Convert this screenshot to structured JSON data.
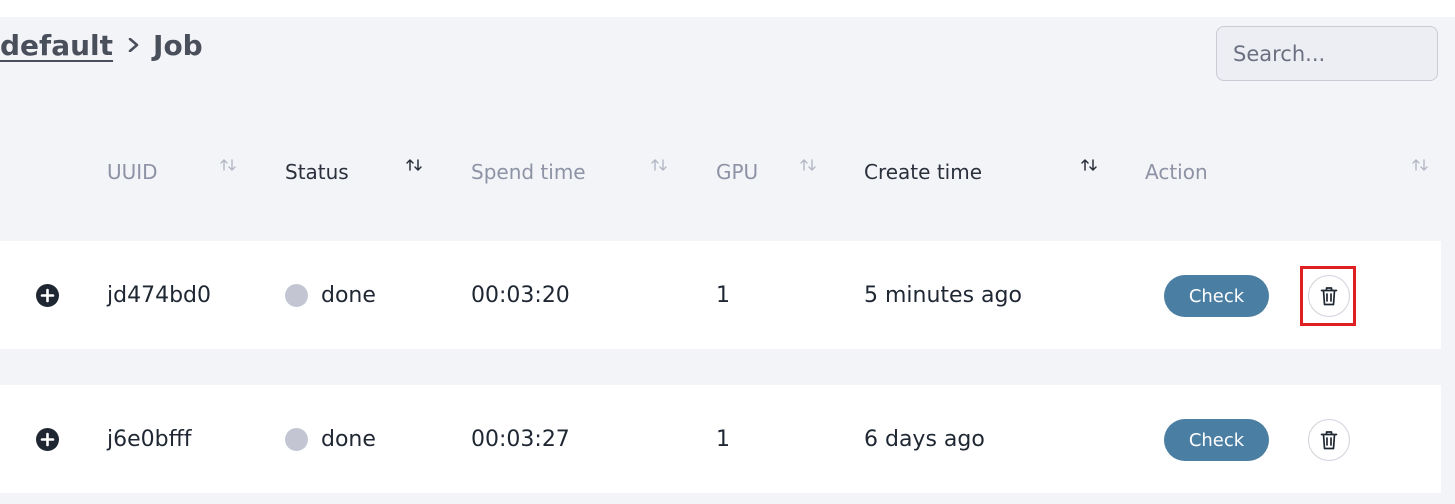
{
  "breadcrumb": {
    "parent": "default",
    "current": "Job"
  },
  "search": {
    "placeholder": "Search..."
  },
  "table": {
    "columns": [
      {
        "key": "uuid",
        "label": "UUID",
        "sort": "none"
      },
      {
        "key": "status",
        "label": "Status",
        "sort": "active"
      },
      {
        "key": "spend_time",
        "label": "Spend time",
        "sort": "none"
      },
      {
        "key": "gpu",
        "label": "GPU",
        "sort": "none"
      },
      {
        "key": "create_time",
        "label": "Create time",
        "sort": "active"
      },
      {
        "key": "action",
        "label": "Action",
        "sort": "none"
      }
    ],
    "rows": [
      {
        "uuid": "jd474bd0",
        "status": "done",
        "spend_time": "00:03:20",
        "gpu": "1",
        "create_time": "5 minutes ago",
        "action_label": "Check",
        "highlighted": true
      },
      {
        "uuid": "j6e0bfff",
        "status": "done",
        "spend_time": "00:03:27",
        "gpu": "1",
        "create_time": "6 days ago",
        "action_label": "Check",
        "highlighted": false
      }
    ]
  },
  "icons": {
    "breadcrumb_separator": "chevron-right-icon",
    "sort": "sort-arrows-icon",
    "expand": "plus-circle-icon",
    "delete": "trash-icon",
    "status": "status-dot-icon"
  },
  "colors": {
    "check_button": "#4a7ea3",
    "status_done": "#c3c6d2",
    "highlight": "#e02020",
    "page_background": "#f3f4f8"
  }
}
